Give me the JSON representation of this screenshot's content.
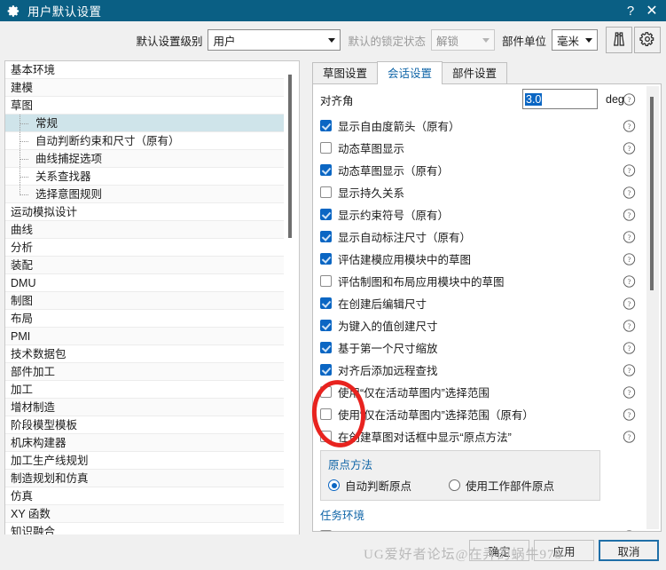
{
  "window": {
    "title": "用户默认设置",
    "title_icon": "gear-icon",
    "help_button": "?",
    "close_button": "✕"
  },
  "toolbar": {
    "level_label": "默认设置级别",
    "level_value": "用户",
    "lock_label": "默认的锁定状态",
    "lock_value": "解锁",
    "unit_label": "部件单位",
    "unit_value": "毫米",
    "find_icon": "binoculars-icon",
    "settings_icon": "gear-icon"
  },
  "tree": {
    "items": [
      {
        "label": "基本环境",
        "level": 0,
        "selected": false
      },
      {
        "label": "建模",
        "level": 0,
        "selected": false
      },
      {
        "label": "草图",
        "level": 0,
        "selected": false
      },
      {
        "label": "常规",
        "level": 1,
        "selected": true
      },
      {
        "label": "自动判断约束和尺寸（原有）",
        "level": 1,
        "selected": false
      },
      {
        "label": "曲线捕捉选项",
        "level": 1,
        "selected": false
      },
      {
        "label": "关系查找器",
        "level": 1,
        "selected": false
      },
      {
        "label": "选择意图规则",
        "level": 1,
        "selected": false,
        "last": true
      },
      {
        "label": "运动模拟设计",
        "level": 0,
        "selected": false
      },
      {
        "label": "曲线",
        "level": 0,
        "selected": false
      },
      {
        "label": "分析",
        "level": 0,
        "selected": false
      },
      {
        "label": "装配",
        "level": 0,
        "selected": false
      },
      {
        "label": "DMU",
        "level": 0,
        "selected": false
      },
      {
        "label": "制图",
        "level": 0,
        "selected": false
      },
      {
        "label": "布局",
        "level": 0,
        "selected": false
      },
      {
        "label": "PMI",
        "level": 0,
        "selected": false
      },
      {
        "label": "技术数据包",
        "level": 0,
        "selected": false
      },
      {
        "label": "部件加工",
        "level": 0,
        "selected": false
      },
      {
        "label": "加工",
        "level": 0,
        "selected": false
      },
      {
        "label": "增材制造",
        "level": 0,
        "selected": false
      },
      {
        "label": "阶段模型模板",
        "level": 0,
        "selected": false
      },
      {
        "label": "机床构建器",
        "level": 0,
        "selected": false
      },
      {
        "label": "加工生产线规划",
        "level": 0,
        "selected": false
      },
      {
        "label": "制造规划和仿真",
        "level": 0,
        "selected": false
      },
      {
        "label": "仿真",
        "level": 0,
        "selected": false
      },
      {
        "label": "XY 函数",
        "level": 0,
        "selected": false
      },
      {
        "label": "知识融合",
        "level": 0,
        "selected": false
      }
    ]
  },
  "tabs": [
    {
      "label": "草图设置",
      "active": false
    },
    {
      "label": "会话设置",
      "active": true
    },
    {
      "label": "部件设置",
      "active": false
    }
  ],
  "panel": {
    "align_angle": {
      "label": "对齐角",
      "value": "3.0",
      "unit": "deg"
    },
    "checkboxes": [
      {
        "label": "显示自由度箭头（原有）",
        "checked": true
      },
      {
        "label": "动态草图显示",
        "checked": false
      },
      {
        "label": "动态草图显示（原有）",
        "checked": true
      },
      {
        "label": "显示持久关系",
        "checked": false
      },
      {
        "label": "显示约束符号（原有）",
        "checked": true
      },
      {
        "label": "显示自动标注尺寸（原有）",
        "checked": true
      },
      {
        "label": "评估建模应用模块中的草图",
        "checked": true
      },
      {
        "label": "评估制图和布局应用模块中的草图",
        "checked": false
      },
      {
        "label": "在创建后编辑尺寸",
        "checked": true
      },
      {
        "label": "为键入的值创建尺寸",
        "checked": true
      },
      {
        "label": "基于第一个尺寸缩放",
        "checked": true
      },
      {
        "label": "对齐后添加远程查找",
        "checked": true
      },
      {
        "label": "使用“仅在活动草图内”选择范围",
        "checked": false
      },
      {
        "label": "使用“仅在活动草图内”选择范围（原有）",
        "checked": false
      },
      {
        "label": "在创建草图对话框中显示“原点方法”",
        "checked": false
      }
    ],
    "origin_group": {
      "title": "原点方法",
      "options": [
        {
          "label": "自动判断原点",
          "selected": true
        },
        {
          "label": "使用工作部件原点",
          "selected": false
        }
      ]
    },
    "task_section": {
      "title": "任务环境"
    }
  },
  "footer": {
    "buttons": [
      {
        "label": "确定",
        "focused": false
      },
      {
        "label": "应用",
        "focused": false
      },
      {
        "label": "取消",
        "focused": true
      }
    ],
    "watermark": "UG爱好者论坛@在弄的蜗牛978"
  },
  "colors": {
    "titlebar": "#0a5f84",
    "accent": "#0b66c3",
    "link": "#1166a8",
    "selection": "#cfe4ea",
    "annotation": "#e8231f"
  }
}
